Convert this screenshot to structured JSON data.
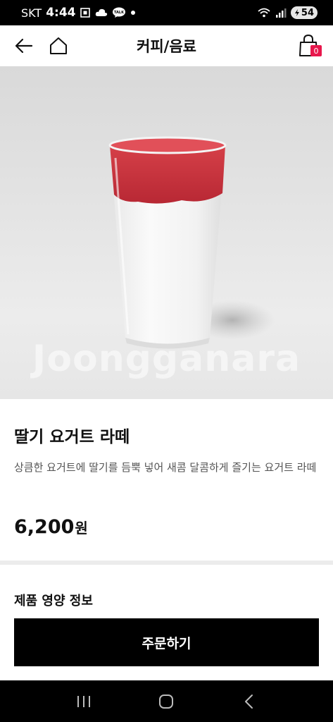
{
  "status_bar": {
    "carrier": "SKT",
    "time": "4:44",
    "talk_label": "TALK",
    "battery": "54"
  },
  "header": {
    "title": "커피/음료",
    "cart_count": "0"
  },
  "hero": {
    "watermark": "Joongganara"
  },
  "product": {
    "name": "딸기 요거트 라떼",
    "description": "상큼한 요거트에 딸기를 듬뿍 넣어 새콤 달콤하게 즐기는 요거트 라떼",
    "price": "6,200",
    "price_unit": "원"
  },
  "sections": {
    "nutrition_title": "제품 영양 정보"
  },
  "order": {
    "button_label": "주문하기"
  },
  "icons": {
    "back": "arrow-left-icon",
    "home": "home-icon",
    "cart": "shopping-bag-icon",
    "recents": "recents-icon",
    "nav_home": "nav-home-icon",
    "nav_back": "nav-back-icon"
  },
  "colors": {
    "badge": "#e8174c",
    "button_bg": "#000000",
    "strawberry": "#c8343d"
  }
}
